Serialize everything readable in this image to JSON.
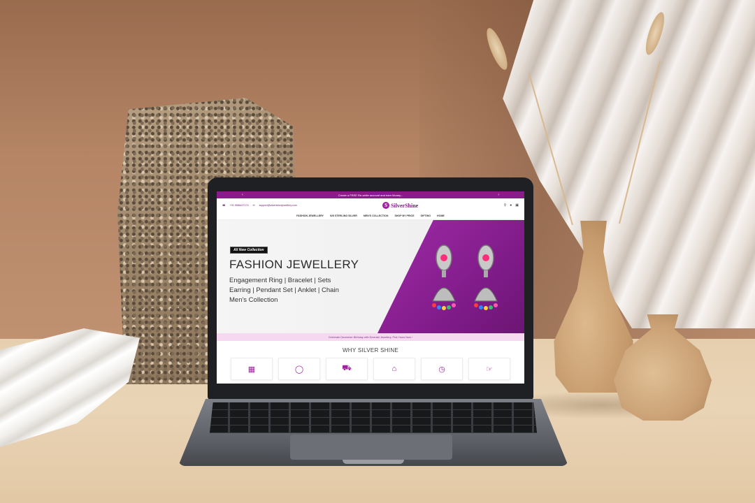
{
  "site": {
    "promo_text": "Create a FREE Re-seller account and earn Money...",
    "promo_prev": "‹",
    "promo_next": "›",
    "phone": "+91 9586427174",
    "email": "support@silvershinejewellery.com",
    "logo_text": "SilverShine",
    "logo_mark": "S",
    "icons": [
      "search-icon",
      "user-icon",
      "cart-icon"
    ],
    "nav": [
      "FASHION JEWELLERY",
      "925 STERLING SILVER",
      "MEN'S COLLECTION",
      "SHOP BY PRICE",
      "GIFTING",
      "HOME"
    ],
    "hero": {
      "badge": "All New Collection",
      "title": "FASHION JEWELLERY",
      "sub_line1": "Engagement Ring | Bracelet | Sets",
      "sub_line2": "Earring | Pendant Set | Anklet | Chain",
      "sub_line3": "Men's Collection"
    },
    "banner": "Celebrate December Birthday with Emerald Jewellery, Pick Yours Now ›",
    "why_title": "WHY SILVER SHINE",
    "features": [
      "certificate-icon",
      "ring-icon",
      "shipping-icon",
      "home-icon",
      "clock-icon",
      "hand-icon"
    ]
  },
  "colors": {
    "brand": "#8b1a8e",
    "hero_purple": "#7d1a86",
    "banner_pink": "#f6d9f1"
  }
}
